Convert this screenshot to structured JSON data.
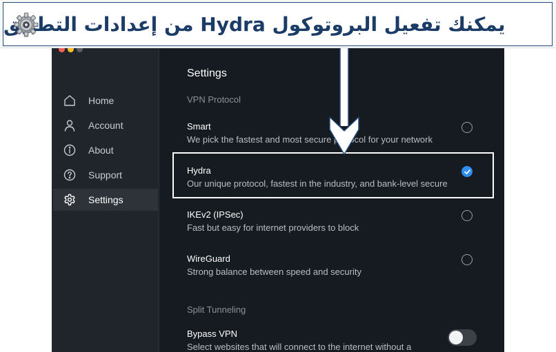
{
  "banner": {
    "text": "يمكنك تفعيل البروتوكول Hydra من إعدادات التطبيق",
    "icon": "gear-icon"
  },
  "colors": {
    "accent": "#2f8ff0",
    "sidebar_bg": "#20252c",
    "main_bg": "#161b21",
    "banner_text": "#1b3c66"
  },
  "window": {
    "traffic_lights": [
      "#ff5f57",
      "#febc2e",
      "#5a5f66"
    ]
  },
  "sidebar": {
    "items": [
      {
        "label": "Home",
        "icon": "home-icon"
      },
      {
        "label": "Account",
        "icon": "user-icon"
      },
      {
        "label": "About",
        "icon": "info-icon"
      },
      {
        "label": "Support",
        "icon": "help-icon"
      },
      {
        "label": "Settings",
        "icon": "gear-icon",
        "active": true
      }
    ]
  },
  "main": {
    "title": "Settings",
    "vpn_protocol": {
      "heading": "VPN Protocol",
      "options": [
        {
          "name": "Smart",
          "description": "We pick the fastest and most secure protocol for your network",
          "selected": false
        },
        {
          "name": "Hydra",
          "description": "Our unique protocol, fastest in the industry, and bank-level secure",
          "selected": true
        },
        {
          "name": "IKEv2 (IPSec)",
          "description": "Fast but easy for internet providers to block",
          "selected": false
        },
        {
          "name": "WireGuard",
          "description": "Strong balance between speed and security",
          "selected": false
        }
      ]
    },
    "split_tunneling": {
      "heading": "Split Tunneling",
      "bypass": {
        "name": "Bypass VPN",
        "description": "Select websites that will connect to the internet without a",
        "enabled": false
      }
    }
  }
}
